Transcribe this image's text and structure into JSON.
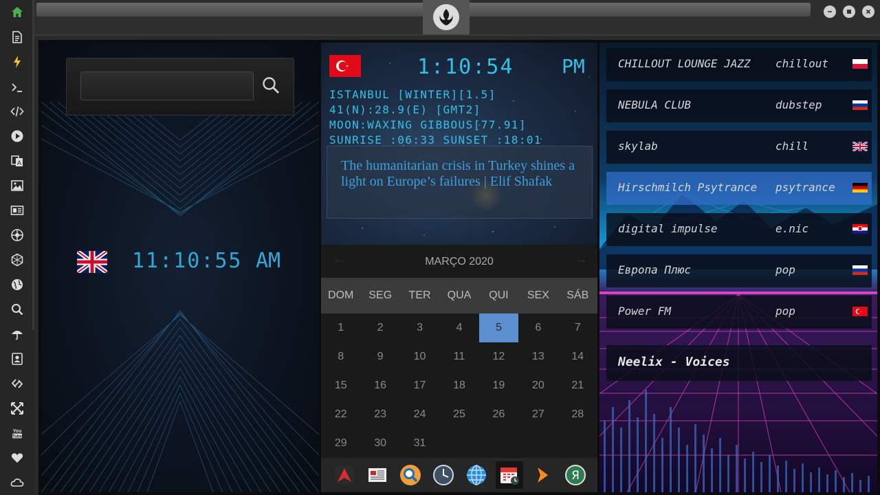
{
  "sidebar": {
    "items": [
      {
        "icon": "home-icon"
      },
      {
        "icon": "document-icon"
      },
      {
        "icon": "lightning-icon"
      },
      {
        "icon": "terminal-icon"
      },
      {
        "icon": "code-icon"
      },
      {
        "icon": "play-icon"
      },
      {
        "icon": "translate-icon"
      },
      {
        "icon": "image-icon"
      },
      {
        "icon": "news-icon"
      },
      {
        "icon": "aperture-icon"
      },
      {
        "icon": "hexagon-icon"
      },
      {
        "icon": "globe-icon"
      },
      {
        "icon": "search-icon"
      },
      {
        "icon": "umbrella-icon"
      },
      {
        "icon": "contacts-icon"
      },
      {
        "icon": "link-icon"
      },
      {
        "icon": "expand-icon"
      },
      {
        "icon": "youtube-icon"
      },
      {
        "icon": "heart-icon"
      },
      {
        "icon": "cloud-icon"
      }
    ]
  },
  "left_clock": {
    "time": "11:10:55",
    "ampm": "AM",
    "flag": "uk-flag-icon"
  },
  "search": {
    "value": "",
    "placeholder": ""
  },
  "world_clock": {
    "time": "1:10:54",
    "ampm": "PM",
    "flag": "turkey-flag-icon",
    "line1": "ISTANBUL [WINTER][1.5]",
    "line2": "41(N):28.9(E) [GMT2]",
    "line3": "MOON:WAXING GIBBOUS[77.91]",
    "line4": "SUNRISE_:06:33 SUNSET_:18:01"
  },
  "news": {
    "headline": "The humanitarian crisis in Turkey shines a light on Europe’s failures | Elif Shafak"
  },
  "calendar": {
    "title": "MARÇO 2020",
    "prev": "←",
    "next": "→",
    "weekdays": [
      "DOM",
      "SEG",
      "TER",
      "QUA",
      "QUI",
      "SEX",
      "SÁB"
    ],
    "weeks": [
      [
        "1",
        "2",
        "3",
        "4",
        "5",
        "6",
        "7"
      ],
      [
        "8",
        "9",
        "10",
        "11",
        "12",
        "13",
        "14"
      ],
      [
        "15",
        "16",
        "17",
        "18",
        "19",
        "20",
        "21"
      ],
      [
        "22",
        "23",
        "24",
        "25",
        "26",
        "27",
        "28"
      ],
      [
        "29",
        "30",
        "31",
        "",
        "",
        "",
        ""
      ]
    ],
    "today": "5"
  },
  "dock": {
    "items": [
      "app-launcher-icon",
      "news-reader-icon",
      "magnifier-icon",
      "clock-icon",
      "browser-globe-icon",
      "calendar-icon",
      "play-arrow-icon",
      "yandex-icon"
    ],
    "active": "calendar-icon"
  },
  "radio": {
    "stations": [
      {
        "name": "CHILLOUT LOUNGE JAZZ",
        "genre": "chillout",
        "flag": "poland-flag-icon"
      },
      {
        "name": "NEBULA CLUB",
        "genre": "dubstep",
        "flag": "russia-flag-icon"
      },
      {
        "name": "skylab",
        "genre": "chill",
        "flag": "uk-flag-icon"
      },
      {
        "name": "Hirschmilch Psytrance",
        "genre": "psytrance",
        "flag": "germany-flag-icon"
      },
      {
        "name": "digital impulse",
        "genre": "e.nic",
        "flag": "croatia-flag-icon"
      },
      {
        "name": "Европа Плюс",
        "genre": "pop",
        "flag": "russia-flag-icon"
      },
      {
        "name": "Power FM",
        "genre": "pop",
        "flag": "turkey-flag-icon"
      }
    ],
    "active_index": 3,
    "now_playing": "Neelix - Voices"
  },
  "colors": {
    "clock": "#34c0e6",
    "news_link": "#3b9fe0",
    "calendar_today": "#5b8fd0",
    "sidebar_active": "#4caf50",
    "station_active": "#3a7ecf"
  }
}
